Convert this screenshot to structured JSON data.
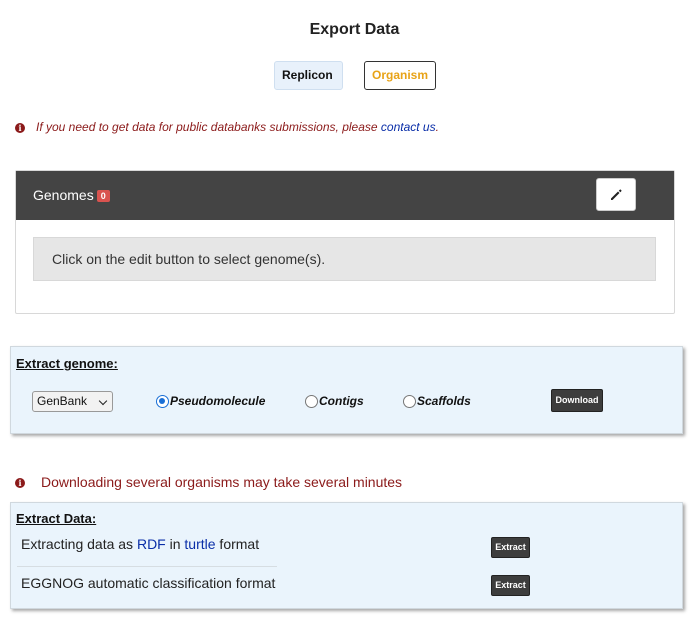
{
  "page": {
    "title": "Export Data"
  },
  "tabs": {
    "replicon": "Replicon",
    "organism": "Organism"
  },
  "info": {
    "text": "If you need to get data for public databanks submissions, please ",
    "link": "contact us",
    "suffix": "."
  },
  "genomes": {
    "label": "Genomes",
    "count": "0",
    "message": "Click on the edit button to select genome(s)."
  },
  "extract_genome": {
    "title": "Extract genome:",
    "format_selected": "GenBank",
    "options": {
      "pseudomolecule": "Pseudomolecule",
      "contigs": "Contigs",
      "scaffolds": "Scaffolds"
    },
    "selected_option": "Pseudomolecule",
    "download_label": "Download"
  },
  "warning": {
    "text": "Downloading several organisms may take several minutes"
  },
  "extract_data": {
    "title": "Extract Data:",
    "rdf_row": {
      "prefix": "Extracting data as ",
      "rdf_link": "RDF",
      "middle": " in ",
      "turtle_link": "turtle",
      "suffix": " format"
    },
    "eggnog_row": "EGGNOG automatic classification format",
    "extract_label": "Extract"
  },
  "colors": {
    "header_bg": "#444444",
    "badge": "#d9534f",
    "warning_text": "#8b1a1a",
    "link": "#0a2ea8",
    "organism_tab": "#e8a317",
    "panel_bg": "#eaf4fc"
  }
}
